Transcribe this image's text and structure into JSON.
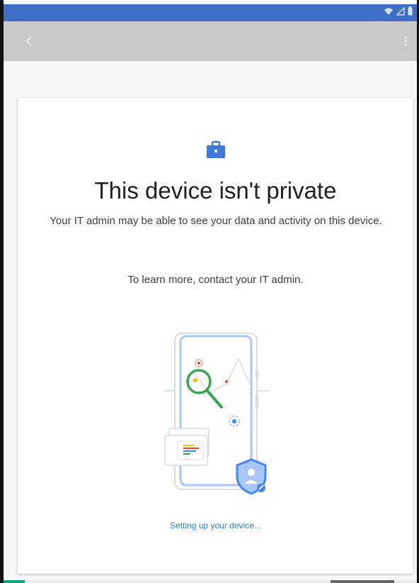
{
  "status_bar": {
    "icons": [
      "wifi-icon",
      "signal-icon",
      "battery-icon"
    ]
  },
  "app_bar": {
    "icons": [
      "back-arrow-icon",
      "more-vert-icon"
    ]
  },
  "card": {
    "title": "This device isn't private",
    "subtitle": "Your IT admin may be able to see your data and activity on this device.",
    "learn_more": "To learn more, contact your IT admin.",
    "setup_link": "Setting up your device..."
  },
  "colors": {
    "status_bar": "#3f6fc4",
    "app_bar": "#c9c9c9",
    "link": "#2f7fd1",
    "briefcase": "#3f78d8"
  }
}
